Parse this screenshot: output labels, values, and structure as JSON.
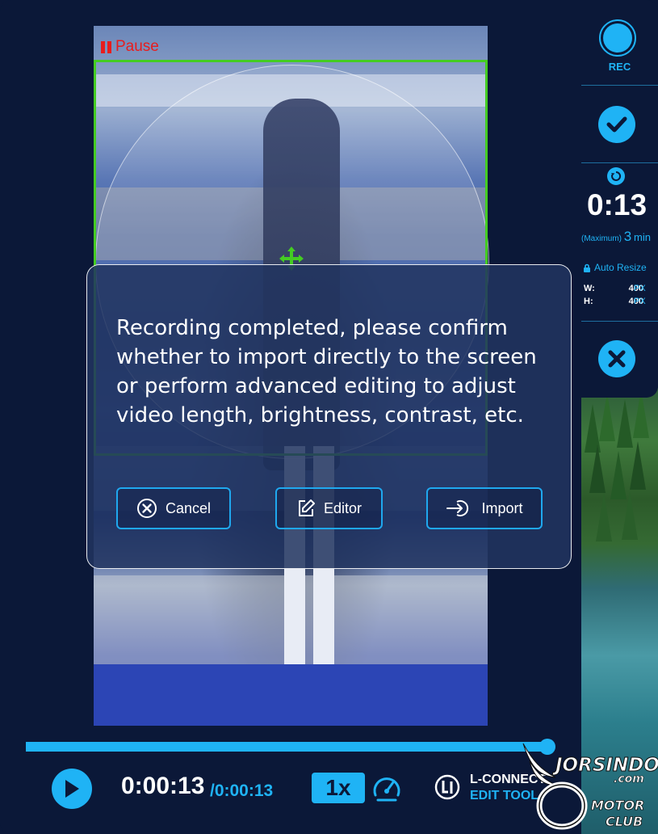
{
  "recorder": {
    "pause_label": "Pause",
    "rec_label": "REC",
    "elapsed": "0:13",
    "max_prefix": "(Maximum)",
    "max_value": "3",
    "max_unit": "min",
    "auto_resize_label": "Auto Resize",
    "width_label": "W:",
    "width_value": "400",
    "height_label": "H:",
    "height_value": "400",
    "px_unit": "PX"
  },
  "dialog": {
    "message": "Recording completed, please confirm whether to import directly to the screen or perform advanced editing to adjust video length, brightness, contrast, etc.",
    "cancel_label": "Cancel",
    "editor_label": "Editor",
    "import_label": "Import"
  },
  "player": {
    "current_time": "0:00:13",
    "total_time": "/0:00:13",
    "progress": 1.0,
    "speed": "1x"
  },
  "brand": {
    "name": "L-CONNECT",
    "sub": "EDIT TOOL"
  },
  "watermark": {
    "line1": "JORSINDO",
    "line2": ".com",
    "line3": "MOTOR",
    "line4": "CLUB"
  },
  "colors": {
    "background": "#0b1838",
    "accent": "#1fb3f5",
    "pause_red": "#e81d1d",
    "selection_green": "#44cc22"
  },
  "icons": [
    "record-icon",
    "check-icon",
    "timer-reset-icon",
    "lock-icon",
    "close-icon",
    "move-icon",
    "cancel-circle-x-icon",
    "edit-icon",
    "import-icon",
    "play-icon",
    "speedometer-icon",
    "l-connect-logo-icon"
  ]
}
